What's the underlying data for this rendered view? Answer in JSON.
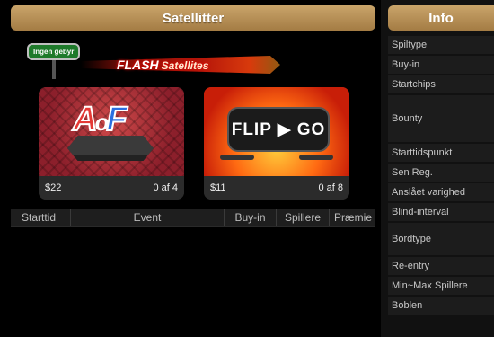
{
  "satellites": {
    "title": "Satellitter",
    "banner": {
      "sign_text": "Ingen gebyr",
      "flash_text": "FLASH",
      "flash_sub": "Satellites"
    },
    "cards": [
      {
        "name": "AoF",
        "price": "$22",
        "count": "0 af 4"
      },
      {
        "name": "FLIP GO",
        "price": "$11",
        "count": "0 af 8"
      }
    ],
    "table": {
      "columns": [
        "Starttid",
        "Event",
        "Buy-in",
        "Spillere",
        "Præmie"
      ]
    }
  },
  "info": {
    "title": "Info",
    "rows": [
      "Spiltype",
      "Buy-in",
      "Startchips",
      "Bounty",
      "Starttidspunkt",
      "Sen Reg.",
      "Anslået varighed",
      "Blind-interval",
      "Bordtype",
      "Re-entry",
      "Min~Max Spillere",
      "Boblen"
    ]
  },
  "colors": {
    "header_gold": "#b98f55",
    "background": "#000000"
  }
}
